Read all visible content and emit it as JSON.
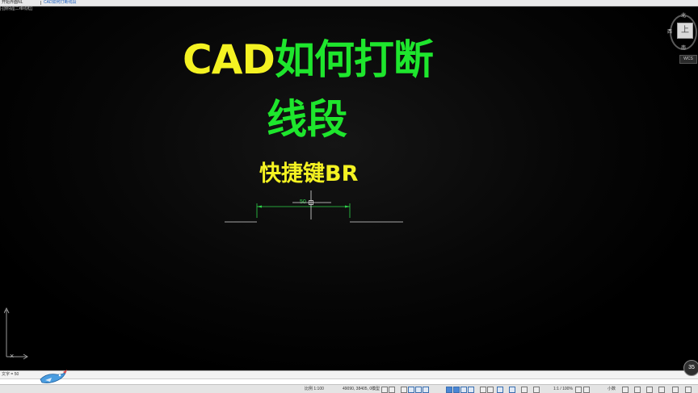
{
  "tabs": [
    {
      "label": "开始界面NL",
      "active": false
    },
    {
      "label": "CAD如何打断线段",
      "active": true
    }
  ],
  "viewport_label": "[-][俯视][二维线框]",
  "title": {
    "part1": "CAD",
    "part2": "如何打断",
    "line2": "线段"
  },
  "subtitle": "快捷键BR",
  "dimension": {
    "value": "50"
  },
  "viewcube": {
    "north": "北",
    "west": "西",
    "south": "南",
    "face": "上",
    "wcs": "WCS"
  },
  "command": {
    "history": "文字 = 50",
    "close": "×"
  },
  "statusbar": {
    "scale": "比例 1:100",
    "coords": "49090, 38405, 0",
    "model": "模型",
    "annotation_scale": "1:1 / 100%",
    "units": "小数"
  },
  "badge": "35",
  "colors": {
    "yellow": "#f4f222",
    "green": "#1ee62d",
    "drawing_line": "#d8d8d8",
    "dimension": "#2fd34a"
  }
}
